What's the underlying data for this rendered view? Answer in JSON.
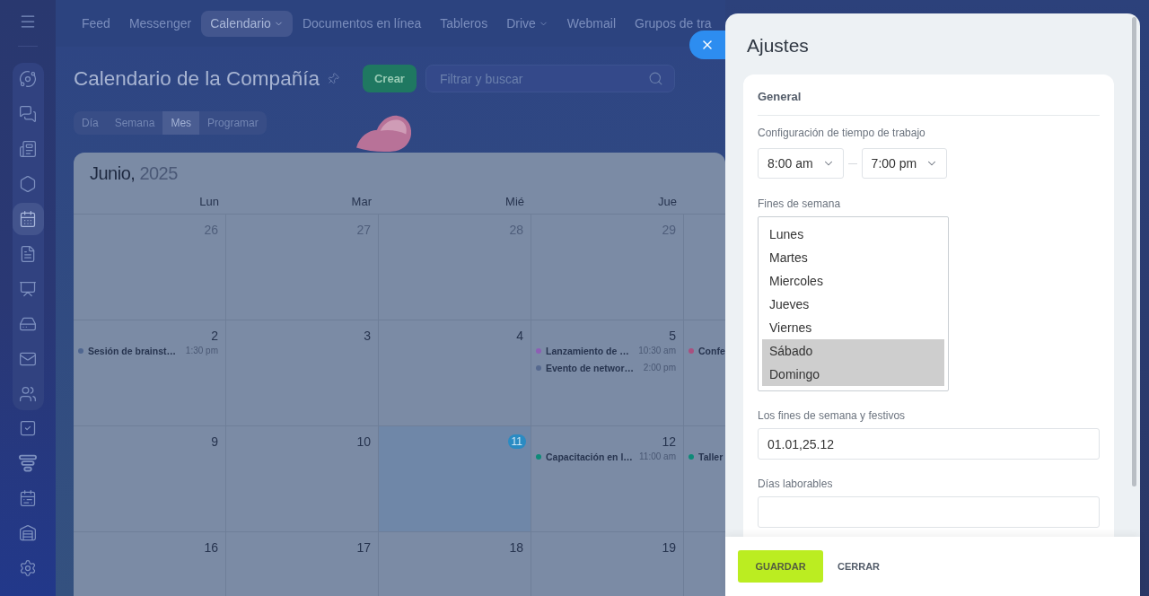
{
  "sidebar": {
    "pinned": [
      {
        "selected": false
      },
      {
        "selected": false
      },
      {
        "selected": false
      },
      {
        "selected": false
      },
      {
        "selected": true
      },
      {
        "selected": false
      },
      {
        "selected": false
      },
      {
        "selected": false
      },
      {
        "selected": false
      },
      {
        "selected": false
      }
    ],
    "items": [
      {
        "selected": false
      },
      {
        "selected": false
      },
      {
        "selected": false
      },
      {
        "selected": false
      },
      {
        "selected": false
      }
    ]
  },
  "top_nav": [
    {
      "label": "Feed",
      "selected": false,
      "dropdown": false
    },
    {
      "label": "Messenger",
      "selected": false,
      "dropdown": false
    },
    {
      "label": "Calendario",
      "selected": true,
      "dropdown": true
    },
    {
      "label": "Documentos en línea",
      "selected": false,
      "dropdown": false
    },
    {
      "label": "Tableros",
      "selected": false,
      "dropdown": false
    },
    {
      "label": "Drive",
      "selected": false,
      "dropdown": true
    },
    {
      "label": "Webmail",
      "selected": false,
      "dropdown": false
    },
    {
      "label": "Grupos de tra",
      "selected": false,
      "dropdown": false
    }
  ],
  "page": {
    "title": "Calendario de la Compañía",
    "create_button": "Crear",
    "search": {
      "placeholder": "Filtrar y buscar"
    },
    "view_tabs": [
      {
        "label": "Día",
        "selected": false
      },
      {
        "label": "Semana",
        "selected": false
      },
      {
        "label": "Mes",
        "selected": true
      },
      {
        "label": "Programar",
        "selected": false
      }
    ]
  },
  "calendar": {
    "month": "Junio,",
    "year": "2025",
    "weekdays": [
      "Lun",
      "Mar",
      "Mié",
      "Jue"
    ],
    "weeks": [
      {
        "days": [
          {
            "day": "26",
            "in_month": false,
            "today": false
          },
          {
            "day": "27",
            "in_month": false,
            "today": false
          },
          {
            "day": "28",
            "in_month": false,
            "today": false
          },
          {
            "day": "29",
            "in_month": false,
            "today": false
          }
        ]
      },
      {
        "days": [
          {
            "day": "2",
            "in_month": true,
            "today": false,
            "events": [
              {
                "title": "Sesión de brainst…",
                "time": "1:30 pm",
                "color": "#4f6690"
              }
            ]
          },
          {
            "day": "3",
            "in_month": true,
            "today": false
          },
          {
            "day": "4",
            "in_month": true,
            "today": false
          },
          {
            "day": "5",
            "in_month": true,
            "today": false,
            "events": [
              {
                "title": "Lanzamiento de …",
                "time": "10:30 am",
                "color": "#8e5fb5"
              },
              {
                "title": "Evento de networ…",
                "time": "2:00 pm",
                "color": "#56698f"
              }
            ]
          }
        ],
        "column_5": {
          "events": [
            {
              "title": "Confe",
              "color": "#a9507f"
            }
          ]
        }
      },
      {
        "days": [
          {
            "day": "9",
            "in_month": true,
            "today": false
          },
          {
            "day": "10",
            "in_month": true,
            "today": false
          },
          {
            "day": "11",
            "in_month": true,
            "today": true
          },
          {
            "day": "12",
            "in_month": true,
            "today": false,
            "events": [
              {
                "title": "Capacitación en l…",
                "time": "11:00 am",
                "color": "#0e8a78"
              }
            ]
          }
        ],
        "column_5": {
          "events": [
            {
              "title": "Taller",
              "color": "#0e8a78"
            }
          ]
        }
      },
      {
        "days": [
          {
            "day": "16",
            "in_month": true,
            "today": false
          },
          {
            "day": "17",
            "in_month": true,
            "today": false
          },
          {
            "day": "18",
            "in_month": true,
            "today": false
          },
          {
            "day": "19",
            "in_month": true,
            "today": false
          }
        ]
      }
    ]
  },
  "settings": {
    "title": "Ajustes",
    "section": "General",
    "work_time": {
      "label": "Configuración de tiempo de trabajo",
      "start": "8:00 am",
      "end": "7:00 pm"
    },
    "weekends": {
      "label": "Fines de semana",
      "options": [
        {
          "label": "Lunes",
          "selected": false
        },
        {
          "label": "Martes",
          "selected": false
        },
        {
          "label": "Miercoles",
          "selected": false
        },
        {
          "label": "Jueves",
          "selected": false
        },
        {
          "label": "Viernes",
          "selected": false
        },
        {
          "label": "Sábado",
          "selected": true
        },
        {
          "label": "Domingo",
          "selected": true
        }
      ]
    },
    "holidays": {
      "label": "Los fines de semana y festivos",
      "value": "01.01,25.12"
    },
    "workdays": {
      "label": "Días laborables"
    },
    "buttons": [
      {
        "label": "GUARDAR",
        "kind": "primary"
      },
      {
        "label": "CERRAR",
        "kind": "link"
      }
    ]
  }
}
